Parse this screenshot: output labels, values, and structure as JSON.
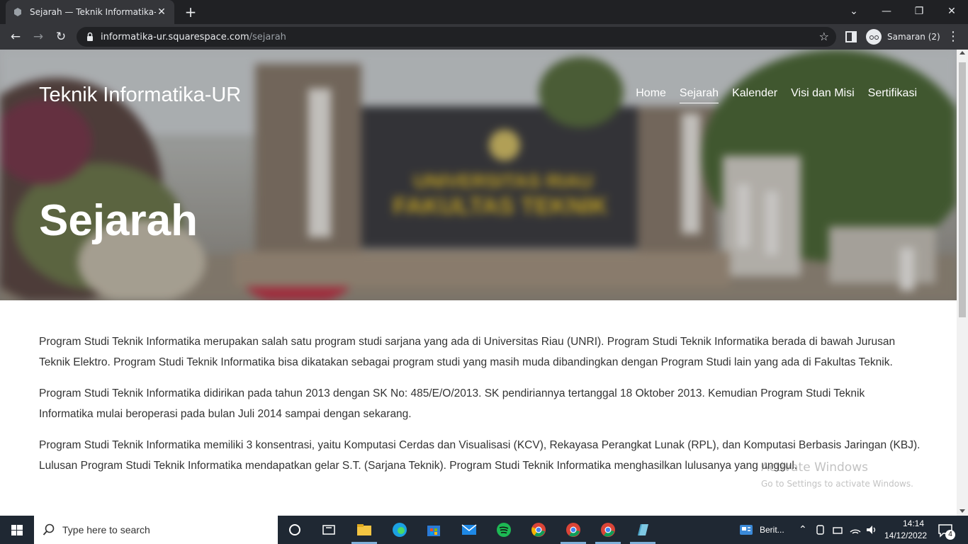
{
  "browser": {
    "tab_title": "Sejarah — Teknik Informatika-UR",
    "url_host": "informatika-ur.squarespace.com",
    "url_path": "/sejarah",
    "profile_label": "Samaran (2)"
  },
  "site": {
    "title": "Teknik Informatika-UR",
    "nav": [
      {
        "label": "Home"
      },
      {
        "label": "Sejarah"
      },
      {
        "label": "Kalender"
      },
      {
        "label": "Visi dan Misi"
      },
      {
        "label": "Sertifikasi"
      }
    ],
    "hero_heading": "Sejarah",
    "hero_sign_line1": "UNIVERSITAS RIAU",
    "hero_sign_line2": "FAKULTAS TEKNIK"
  },
  "content": {
    "paragraphs": [
      "Program Studi Teknik Informatika merupakan salah satu program studi sarjana yang ada di Universitas Riau (UNRI). Program Studi Teknik Informatika berada di bawah Jurusan Teknik Elektro. Program Studi Teknik Informatika bisa dikatakan sebagai program studi yang masih muda dibandingkan dengan Program Studi lain yang ada di Fakultas Teknik.",
      "Program Studi Teknik Informatika didirikan pada tahun 2013 dengan SK No: 485/E/O/2013. SK pendiriannya tertanggal 18 Oktober 2013. Kemudian Program Studi Teknik Informatika mulai beroperasi pada bulan Juli 2014 sampai dengan sekarang.",
      "Program Studi Teknik Informatika memiliki 3 konsentrasi, yaitu Komputasi Cerdas dan Visualisasi (KCV), Rekayasa Perangkat Lunak (RPL), dan Komputasi Berbasis Jaringan (KBJ). Lulusan Program Studi Teknik Informatika mendapatkan gelar S.T. (Sarjana Teknik). Program Studi Teknik Informatika menghasilkan lulusanya yang unggul."
    ]
  },
  "watermark": {
    "title": "Activate Windows",
    "subtitle": "Go to Settings to activate Windows."
  },
  "taskbar": {
    "search_placeholder": "Type here to search",
    "news_label": "Berit...",
    "time": "14:14",
    "date": "14/12/2022",
    "notification_count": "4"
  }
}
